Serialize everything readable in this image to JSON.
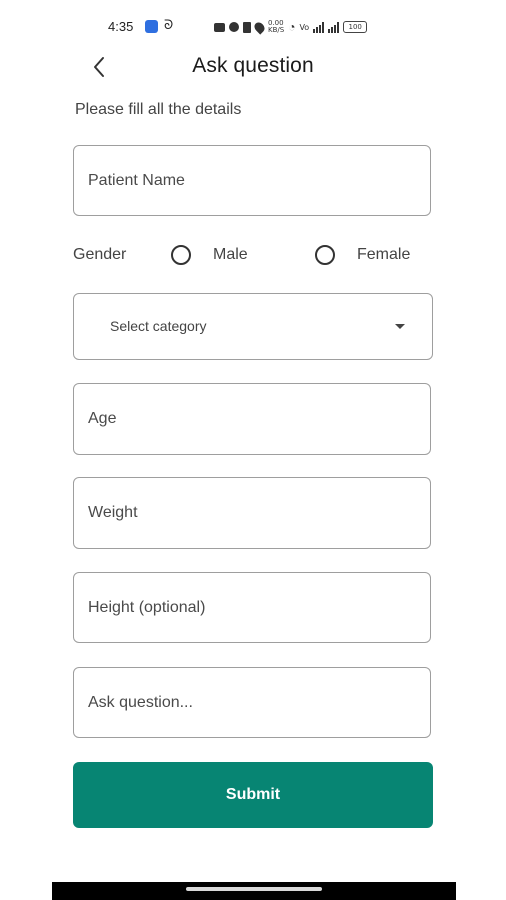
{
  "status_bar": {
    "time": "4:35",
    "battery": "100",
    "icons": [
      "app-notification-icon",
      "app-icon-2",
      "nfc-icon",
      "alarm-icon",
      "vibrate-icon",
      "location-icon",
      "data-speed-icon",
      "wifi-icon",
      "volte-icon",
      "signal-icon-1",
      "signal-icon-2",
      "battery-icon"
    ]
  },
  "header": {
    "title": "Ask question",
    "back_icon": "chevron-left-icon"
  },
  "form": {
    "subtitle": "Please fill all the details",
    "patient_name_placeholder": "Patient Name",
    "gender": {
      "label": "Gender",
      "options": [
        "Male",
        "Female"
      ],
      "selected": null
    },
    "category": {
      "selected_label": "Select category",
      "icon": "dropdown-arrow-icon"
    },
    "age_placeholder": "Age",
    "weight_placeholder": "Weight",
    "height_placeholder": "Height (optional)",
    "question_placeholder": "Ask question...",
    "submit_label": "Submit"
  },
  "colors": {
    "accent": "#078573",
    "border": "#9e9e9e",
    "text": "#444444",
    "title": "#1b1b1b",
    "background": "#ffffff"
  }
}
